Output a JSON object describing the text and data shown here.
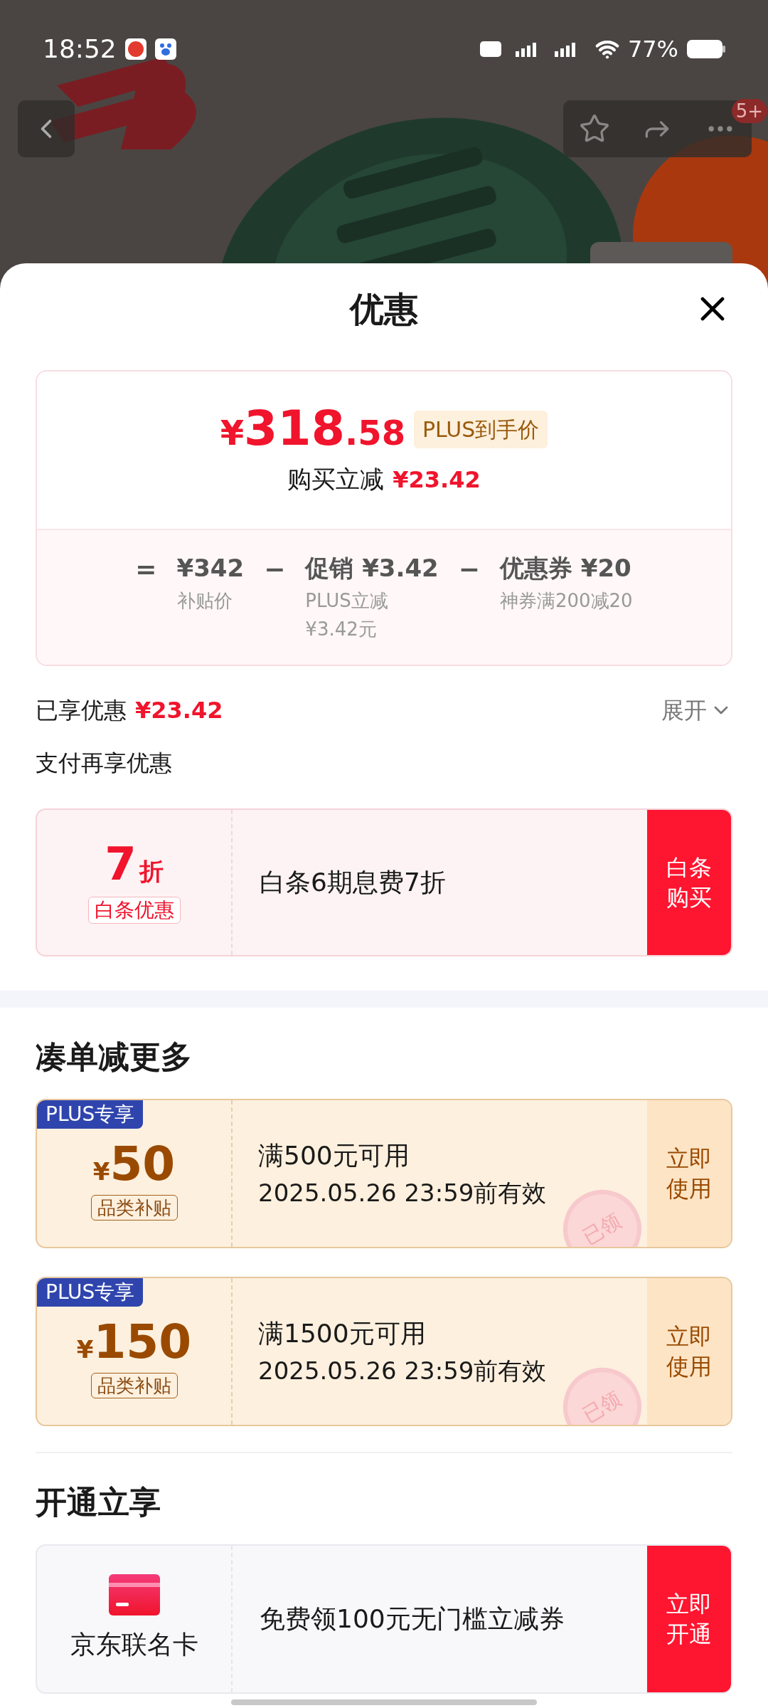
{
  "status_bar": {
    "time": "18:52",
    "battery": "77%"
  },
  "top_bar": {
    "badge": "5+"
  },
  "sheet": {
    "title": "优惠"
  },
  "price_summary": {
    "currency": "¥",
    "integer": "318",
    "decimal": ".58",
    "tag": "PLUS到手价",
    "reduction_label": "购买立减",
    "reduction": "¥23.42",
    "breakdown": [
      {
        "operator": "=",
        "amount": "¥342",
        "notes": [
          "补贴价"
        ]
      },
      {
        "operator": "−",
        "amount": "促销 ¥3.42",
        "notes": [
          "PLUS立减",
          "¥3.42元"
        ]
      },
      {
        "operator": "−",
        "amount": "优惠券 ¥20",
        "notes": [
          "神券满200减20"
        ]
      }
    ]
  },
  "savings": {
    "label": "已享优惠",
    "amount": "¥23.42",
    "toggle": "展开",
    "expanded": false
  },
  "pay_offers": {
    "title": "支付再享优惠",
    "items": [
      {
        "discount": "7",
        "unit": "折",
        "tag": "白条优惠",
        "description": "白条6期息费7折",
        "action": "白条购买"
      }
    ]
  },
  "bundle": {
    "title": "凑单减更多",
    "coupons": [
      {
        "badge": "PLUS专享",
        "currency": "¥",
        "amount": "50",
        "tag": "品类补贴",
        "condition": "满500元可用",
        "validity": "2025.05.26 23:59前有效",
        "stamp": "已领",
        "action": "立即使用"
      },
      {
        "badge": "PLUS专享",
        "currency": "¥",
        "amount": "150",
        "tag": "品类补贴",
        "condition": "满1500元可用",
        "validity": "2025.05.26 23:59前有效",
        "stamp": "已领",
        "action": "立即使用"
      }
    ]
  },
  "membership": {
    "title": "开通立享",
    "items": [
      {
        "name": "京东联名卡",
        "description": "免费领100元无门槛立减券",
        "action": "立即开通"
      }
    ]
  }
}
